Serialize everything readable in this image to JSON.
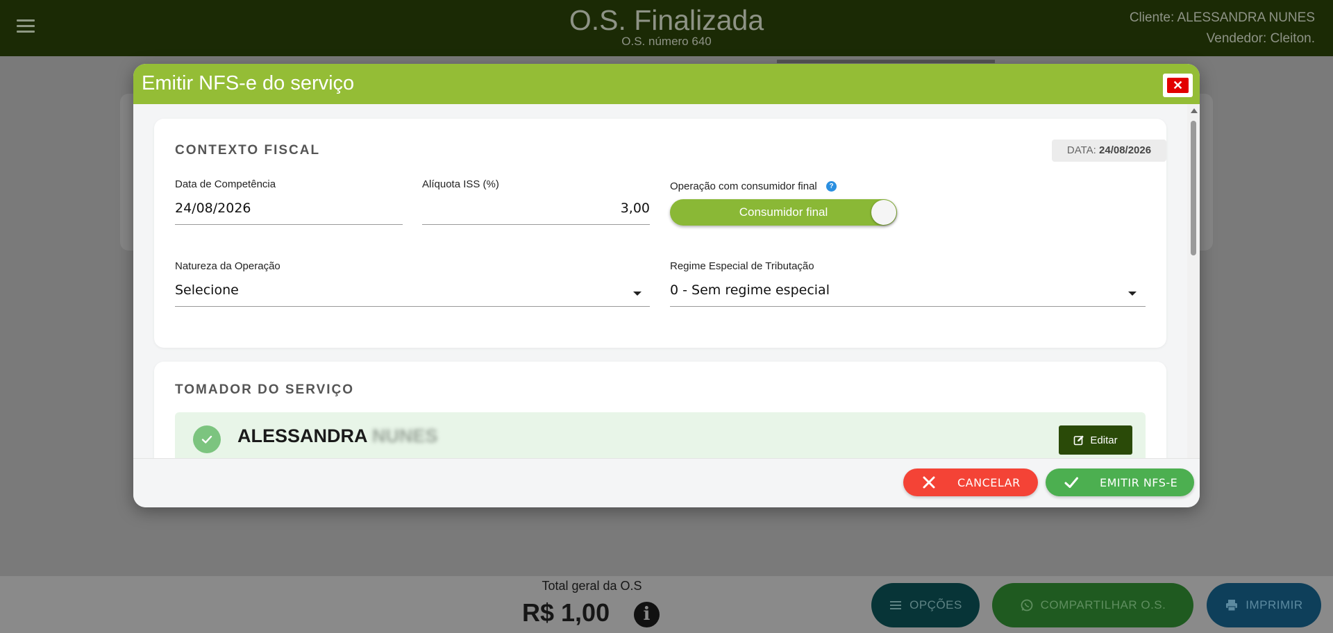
{
  "header": {
    "title": "O.S. Finalizada",
    "subtitle": "O.S. número 640",
    "client": "Cliente: ALESSANDRA NUNES",
    "seller": "Vendedor: Cleiton."
  },
  "footer": {
    "total_label": "Total geral da O.S",
    "total_value": "R$ 1,00",
    "buttons": {
      "options": "OPÇÕES",
      "share": "COMPARTILHAR O.S.",
      "print": "IMPRIMIR"
    }
  },
  "modal": {
    "title": "Emitir NFS-e do serviço",
    "close_icon": "close-icon",
    "fiscal": {
      "title": "CONTEXTO FISCAL",
      "date_label": "DATA:",
      "date_value": "24/08/2026",
      "competencia_label": "Data de Competência",
      "competencia_value": "24/08/2026",
      "aliquota_label": "Alíquota ISS (%)",
      "aliquota_value": "3,00",
      "consumidor_label": "Operação com consumidor final",
      "consumidor_toggle": "Consumidor final",
      "consumidor_on": true,
      "natureza_label": "Natureza da Operação",
      "natureza_value": "Selecione",
      "regime_label": "Regime Especial de Tributação",
      "regime_value": "0 - Sem regime especial"
    },
    "tomador": {
      "title": "TOMADOR DO SERVIÇO",
      "name_first": "ALESSANDRA",
      "name_last": "NUNES",
      "edit_label": "Editar"
    },
    "actions": {
      "cancel": "CANCELAR",
      "emit": "EMITIR NFS-E"
    }
  },
  "colors": {
    "accent": "#94bd36",
    "cancel": "#f44336",
    "emit": "#4caf50",
    "edit": "#2a4a08"
  }
}
